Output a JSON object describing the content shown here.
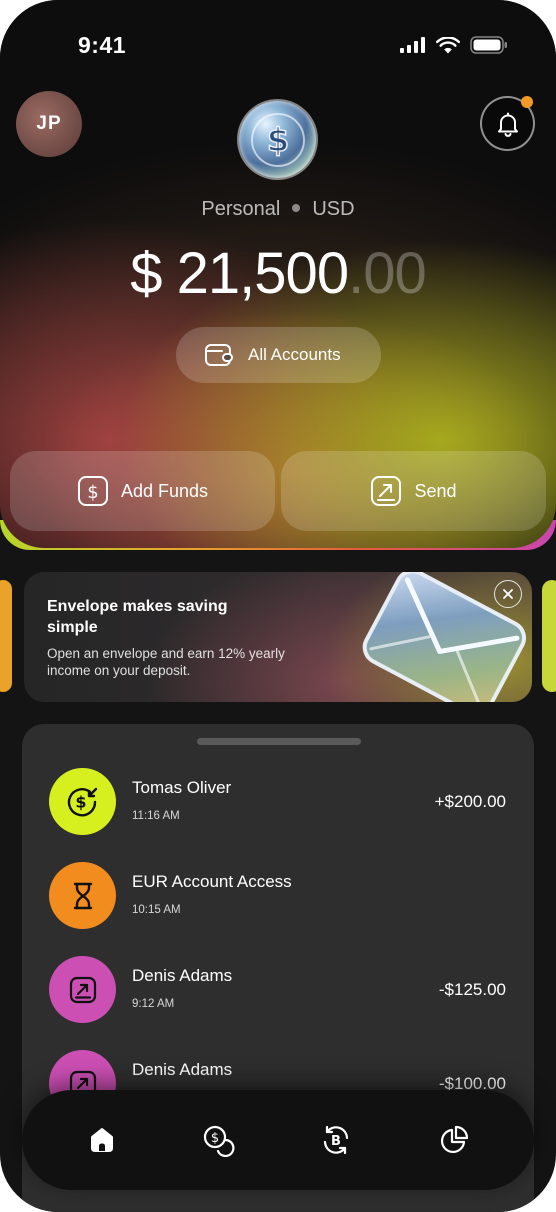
{
  "status_bar": {
    "time": "9:41"
  },
  "header": {
    "avatar_initials": "JP",
    "account_type": "Personal",
    "currency": "USD"
  },
  "balance": {
    "symbol": "$",
    "whole": "21,500",
    "decimal": ".00"
  },
  "all_accounts_label": "All Accounts",
  "actions": {
    "add_funds": "Add Funds",
    "send": "Send"
  },
  "promo": {
    "title": "Envelope makes saving simple",
    "description": "Open an envelope and earn 12% yearly income on your deposit."
  },
  "transactions": [
    {
      "name": "Tomas Oliver",
      "time": "11:16 AM",
      "amount": "+$200.00",
      "icon": "receive-dollar-icon",
      "color": "#d6ef1e"
    },
    {
      "name": "EUR Account Access",
      "time": "10:15 AM",
      "amount": "",
      "icon": "hourglass-icon",
      "color": "#f28c1f"
    },
    {
      "name": "Denis Adams",
      "time": "9:12 AM",
      "amount": "-$125.00",
      "icon": "send-arrow-icon",
      "color": "#cc4fb4"
    },
    {
      "name": "Denis Adams",
      "time": "",
      "amount": "-$100.00",
      "icon": "send-arrow-icon",
      "color": "#cc4fb4"
    }
  ],
  "tabbar": [
    "home-icon",
    "coins-icon",
    "crypto-exchange-icon",
    "pie-chart-icon"
  ],
  "colors": {
    "lime": "#d6ef1e",
    "orange": "#f28c1f",
    "magenta": "#cc4fb4",
    "notification_dot": "#f39a26"
  }
}
